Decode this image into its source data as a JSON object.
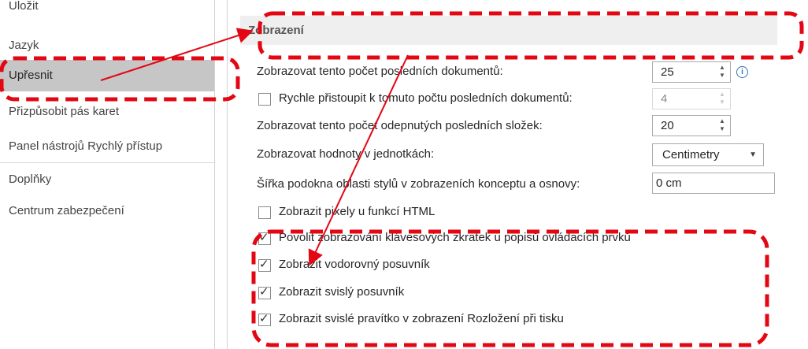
{
  "sidebar": {
    "items": [
      {
        "label": "Uložit"
      },
      {
        "label": "Jazyk"
      },
      {
        "label": "Upřesnit"
      },
      {
        "label": "Přizpůsobit pás karet"
      },
      {
        "label": "Panel nástrojů Rychlý přístup"
      },
      {
        "label": "Doplňky"
      },
      {
        "label": "Centrum zabezpečení"
      }
    ]
  },
  "section": {
    "title": "Zobrazení"
  },
  "options": {
    "recent_docs": {
      "label": "Zobrazovat tento počet posledních dokumentů:",
      "value": "25"
    },
    "quick_access": {
      "label": "Rychle přistoupit k tomuto počtu posledních dokumentů:",
      "value": "4"
    },
    "recent_folders": {
      "label": "Zobrazovat tento počet odepnutých posledních složek:",
      "value": "20"
    },
    "units": {
      "label": "Zobrazovat hodnoty v jednotkách:",
      "value": "Centimetry"
    },
    "style_width": {
      "label": "Šířka podokna oblasti stylů v zobrazeních konceptu a osnovy:",
      "value": "0 cm"
    },
    "html_pixels": {
      "label": "Zobrazit pixely u funkcí HTML"
    },
    "shortcut_keys": {
      "label": "Povolit zobrazování klávesových zkratek u popisů ovládacích prvků"
    },
    "hscroll": {
      "label": "Zobrazit vodorovný posuvník"
    },
    "vscroll": {
      "label": "Zobrazit svislý posuvník"
    },
    "vruler": {
      "label": "Zobrazit svislé pravítko v zobrazení Rozložení při tisku"
    }
  },
  "glyphs": {
    "check": "✓",
    "info": "i",
    "spin_up": "▲",
    "spin_down": "▼",
    "caret": "▼"
  },
  "colors": {
    "annotation": "#e30613",
    "selected_bg": "#c6c6c6",
    "header_bg": "#efefef"
  }
}
